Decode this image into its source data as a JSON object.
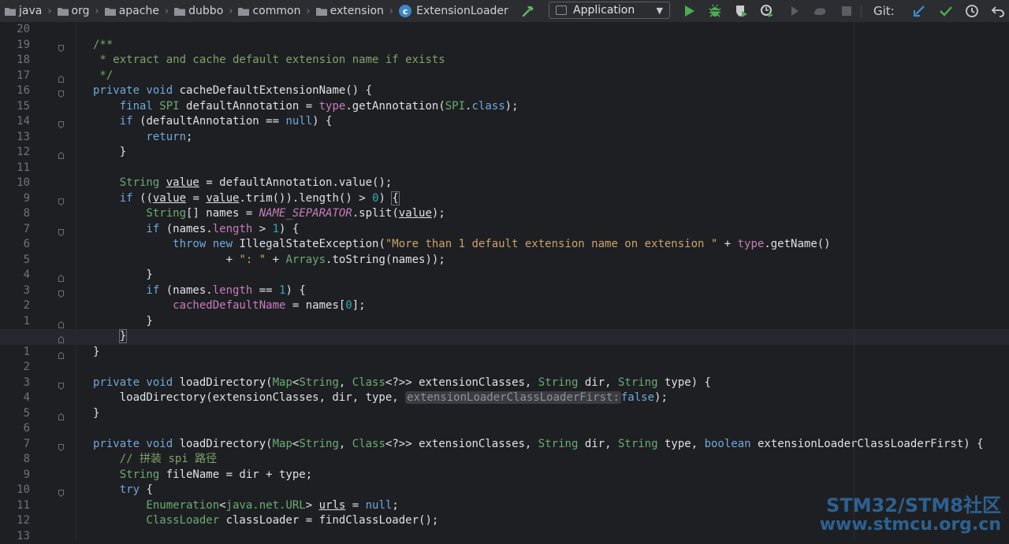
{
  "breadcrumbs": [
    "java",
    "org",
    "apache",
    "dubbo",
    "common",
    "extension",
    "ExtensionLoader"
  ],
  "class_icon_letter": "c",
  "run_config": "Application",
  "git_label": "Git:",
  "watermark": {
    "line1": "STM32/STM8社区",
    "line2": "www.stmcu.org.cn"
  },
  "colors": {
    "keyword": "#cf8e6d",
    "type": "#6aab73",
    "string": "#c9a26d",
    "number": "#2aacb8",
    "comment": "#7ea36b",
    "run": "#4cae4f",
    "accent": "#3f86c6"
  },
  "toolbar_icons": [
    "build-hammer-icon",
    "run-icon",
    "debug-icon",
    "coverage-icon",
    "profile-icon",
    "attach-icon",
    "run-dashboard-icon",
    "stop-icon",
    "git-update-icon",
    "git-commit-icon",
    "git-history-icon",
    "git-rollback-icon"
  ],
  "lines": [
    {
      "n": "20",
      "t": ""
    },
    {
      "n": "19",
      "t": "/**"
    },
    {
      "n": "18",
      "t": " * extract and cache default extension name if exists"
    },
    {
      "n": "17",
      "t": " */"
    },
    {
      "n": "16",
      "t": "private void cacheDefaultExtensionName() {"
    },
    {
      "n": "15",
      "t": "    final SPI defaultAnnotation = type.getAnnotation(SPI.class);"
    },
    {
      "n": "14",
      "t": "    if (defaultAnnotation == null) {"
    },
    {
      "n": "13",
      "t": "        return;"
    },
    {
      "n": "12",
      "t": "    }"
    },
    {
      "n": "11",
      "t": ""
    },
    {
      "n": "10",
      "t": "    String value = defaultAnnotation.value();"
    },
    {
      "n": "9",
      "t": "    if ((value = value.trim()).length() > 0) {"
    },
    {
      "n": "8",
      "t": "        String[] names = NAME_SEPARATOR.split(value);"
    },
    {
      "n": "7",
      "t": "        if (names.length > 1) {"
    },
    {
      "n": "6",
      "t": "            throw new IllegalStateException(\"More than 1 default extension name on extension \" + type.getName()"
    },
    {
      "n": "5",
      "t": "                    + \": \" + Arrays.toString(names));"
    },
    {
      "n": "4",
      "t": "        }"
    },
    {
      "n": "3",
      "t": "        if (names.length == 1) {"
    },
    {
      "n": "2",
      "t": "            cachedDefaultName = names[0];"
    },
    {
      "n": "1",
      "t": "        }"
    },
    {
      "n": "",
      "t": "    }"
    },
    {
      "n": "1",
      "t": "}"
    },
    {
      "n": "2",
      "t": ""
    },
    {
      "n": "3",
      "t": "private void loadDirectory(Map<String, Class<?>> extensionClasses, String dir, String type) {"
    },
    {
      "n": "4",
      "t": "    loadDirectory(extensionClasses, dir, type, extensionLoaderClassLoaderFirst: false);"
    },
    {
      "n": "5",
      "t": "}"
    },
    {
      "n": "6",
      "t": ""
    },
    {
      "n": "7",
      "t": "private void loadDirectory(Map<String, Class<?>> extensionClasses, String dir, String type, boolean extensionLoaderClassLoaderFirst) {"
    },
    {
      "n": "8",
      "t": "    // 拼装 spi 路径"
    },
    {
      "n": "9",
      "t": "    String fileName = dir + type;"
    },
    {
      "n": "10",
      "t": "    try {"
    },
    {
      "n": "11",
      "t": "        Enumeration<java.net.URL> urls = null;"
    },
    {
      "n": "12",
      "t": "        ClassLoader classLoader = findClassLoader();"
    },
    {
      "n": "13",
      "t": ""
    }
  ]
}
